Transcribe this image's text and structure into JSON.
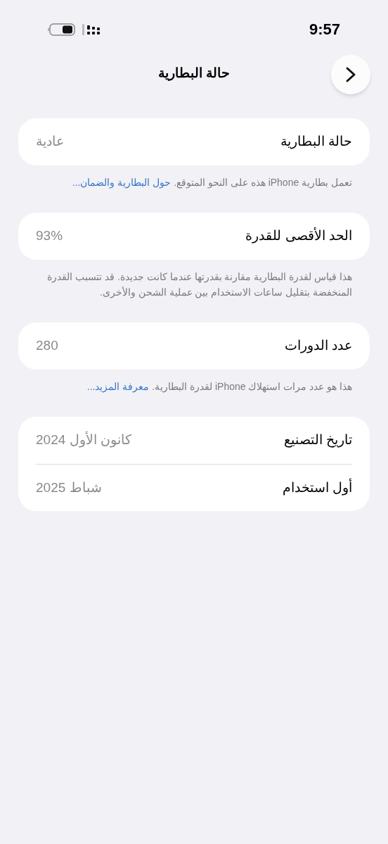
{
  "status_bar": {
    "time": "9:57"
  },
  "nav": {
    "title": "حالة البطارية"
  },
  "groups": [
    {
      "rows": [
        {
          "label": "حالة البطارية",
          "value": "عادية"
        }
      ],
      "footer": {
        "text": "تعمل بطارية iPhone هذه على النحو المتوقع.",
        "link": "حول البطارية والضمان..."
      }
    },
    {
      "rows": [
        {
          "label": "الحد الأقصى للقدرة",
          "value": "93%"
        }
      ],
      "footer": {
        "text": "هذا قياس لقدرة البطارية مقارنة بقدرتها عندما كانت جديدة. قد تتسبب القدرة المنخفضة بتقليل ساعات الاستخدام بين عملية الشحن والأخرى."
      }
    },
    {
      "rows": [
        {
          "label": "عدد الدورات",
          "value": "280"
        }
      ],
      "footer": {
        "text": "هذا هو عدد مرات استهلاك iPhone لقدرة البطارية.",
        "link": "معرفة المزيد..."
      }
    },
    {
      "rows": [
        {
          "label": "تاريخ التصنيع",
          "value": "كانون الأول 2024"
        },
        {
          "label": "أول استخدام",
          "value": "شباط 2025"
        }
      ]
    }
  ]
}
